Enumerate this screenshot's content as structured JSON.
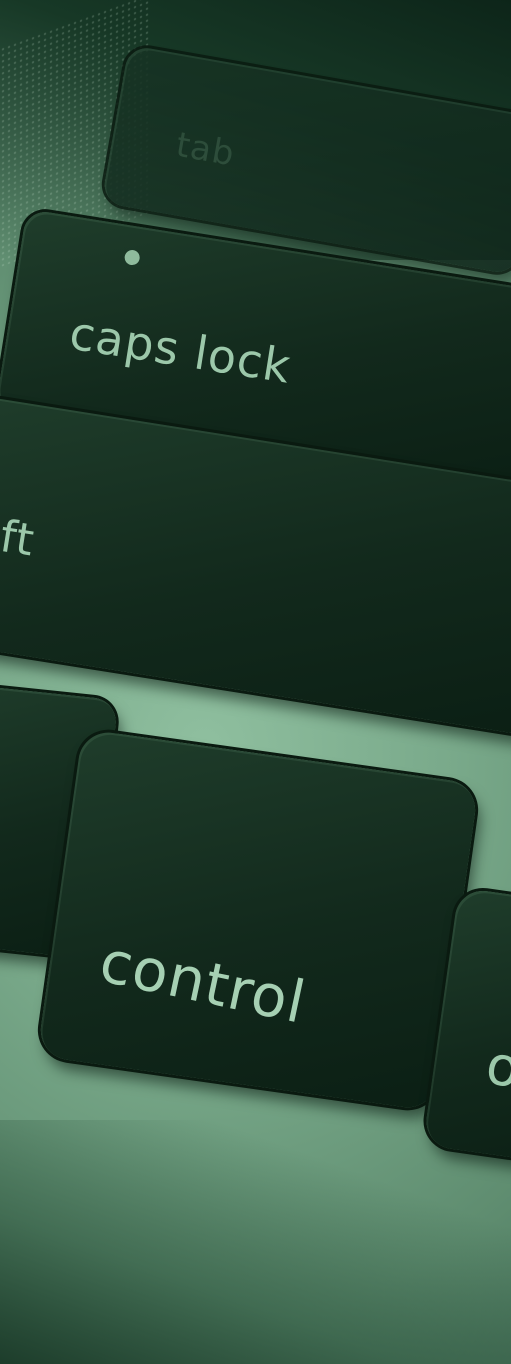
{
  "photo": {
    "subject": "laptop keyboard close-up",
    "tint_color": "#79a98a",
    "key_color": "#12291c",
    "label_color": "#9cc8aa"
  },
  "keys": {
    "tab": {
      "label": "tab"
    },
    "caps_lock": {
      "label": "caps lock"
    },
    "shift": {
      "label": "ift"
    },
    "control": {
      "label": "control"
    },
    "option": {
      "label": "o"
    }
  }
}
